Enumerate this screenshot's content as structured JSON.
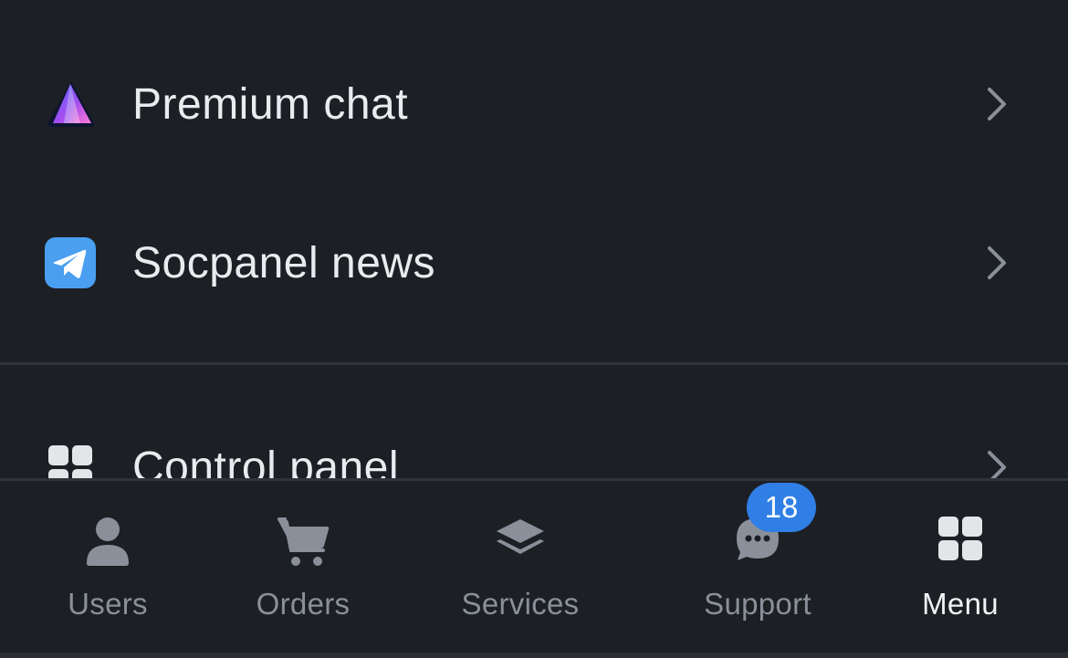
{
  "menu": {
    "items": [
      {
        "label": "Premium chat",
        "icon": "premium-chat-logo-icon"
      },
      {
        "label": "Socpanel news",
        "icon": "telegram-icon"
      },
      {
        "label": "Control panel",
        "icon": "grid-icon"
      }
    ]
  },
  "tabbar": {
    "tabs": [
      {
        "label": "Users",
        "icon": "user-icon",
        "active": false
      },
      {
        "label": "Orders",
        "icon": "cart-icon",
        "active": false
      },
      {
        "label": "Services",
        "icon": "layers-icon",
        "active": false
      },
      {
        "label": "Support",
        "icon": "chat-bubble-icon",
        "active": false,
        "badge": "18"
      },
      {
        "label": "Menu",
        "icon": "grid-icon",
        "active": true
      }
    ]
  },
  "colors": {
    "background": "#1c1f24",
    "divider": "#30343b",
    "text_primary": "#e9ebee",
    "text_muted": "#8a9099",
    "badge": "#2f7fe6",
    "telegram": "#4a9ff0"
  }
}
